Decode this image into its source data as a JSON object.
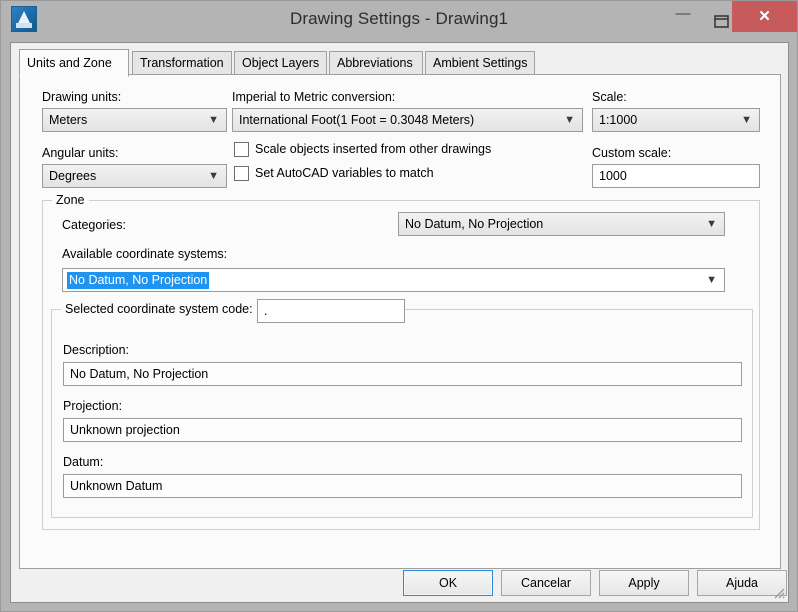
{
  "window": {
    "title": "Drawing Settings - Drawing1",
    "app_icon": "autocad-a-icon",
    "minimize_label": "—",
    "maximize_label": "maximize-icon",
    "close_label": "✕"
  },
  "tabs": [
    {
      "label": "Units and Zone",
      "active": true
    },
    {
      "label": "Transformation",
      "active": false
    },
    {
      "label": "Object Layers",
      "active": false
    },
    {
      "label": "Abbreviations",
      "active": false
    },
    {
      "label": "Ambient Settings",
      "active": false
    }
  ],
  "units": {
    "drawing_units_label": "Drawing units:",
    "drawing_units_value": "Meters",
    "angular_units_label": "Angular units:",
    "angular_units_value": "Degrees",
    "conversion_label": "Imperial to Metric conversion:",
    "conversion_value": "International Foot(1 Foot = 0.3048 Meters)",
    "scale_objects_label": "Scale objects inserted from other drawings",
    "scale_objects_checked": false,
    "set_variables_label": "Set AutoCAD variables to match",
    "set_variables_checked": false,
    "scale_label": "Scale:",
    "scale_value": "1:1000",
    "custom_scale_label": "Custom scale:",
    "custom_scale_value": "1000"
  },
  "zone": {
    "group_title": "Zone",
    "categories_label": "Categories:",
    "categories_value": "No Datum, No Projection",
    "available_label": "Available coordinate systems:",
    "available_value": "No Datum, No Projection",
    "available_selected": true,
    "code_label": "Selected coordinate system code:",
    "code_value": ".",
    "description_label": "Description:",
    "description_value": "No Datum, No Projection",
    "projection_label": "Projection:",
    "projection_value": "Unknown projection",
    "datum_label": "Datum:",
    "datum_value": "Unknown Datum"
  },
  "buttons": {
    "ok": "OK",
    "cancel": "Cancelar",
    "apply": "Apply",
    "help": "Ajuda"
  },
  "colors": {
    "selection_blue": "#1e94f0",
    "close_red": "#c75b5b",
    "titlebar": "#b4b4b4",
    "dialog_face": "#f0f0f0",
    "panel": "#fbfbfb",
    "focus_border": "#2e8ad8"
  }
}
